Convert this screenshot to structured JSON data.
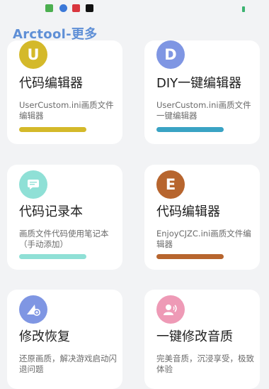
{
  "app_title": "Arctool-更多",
  "colors": {
    "title": "#5f8fd6",
    "yellow": "#d4b92a",
    "blue_teal": "#3aa3c4",
    "mint": "#8fe0d6",
    "brown": "#b7652e",
    "periwinkle": "#7f96e3",
    "pink": "#ee9ab6"
  },
  "cards": [
    {
      "icon_letter": "U",
      "title": "代码编辑器",
      "desc": "UserCustom.ini画质文件编辑器"
    },
    {
      "icon_letter": "D",
      "title": "DIY一键编辑器",
      "desc": "UserCustom.ini画质文件一键编辑器"
    },
    {
      "icon_name": "message-icon",
      "title": "代码记录本",
      "desc": "画质文件代码使用笔记本（手动添加）"
    },
    {
      "icon_letter": "E",
      "title": "代码编辑器",
      "desc": "EnjoyCJZC.ini画质文件编辑器"
    },
    {
      "icon_name": "repair-icon",
      "title": "修改恢复",
      "desc": "还原画质，解决游戏启动闪退问题"
    },
    {
      "icon_name": "audio-icon",
      "title": "一键修改音质",
      "desc": "完美音质，沉浸享受，极致体验"
    }
  ]
}
